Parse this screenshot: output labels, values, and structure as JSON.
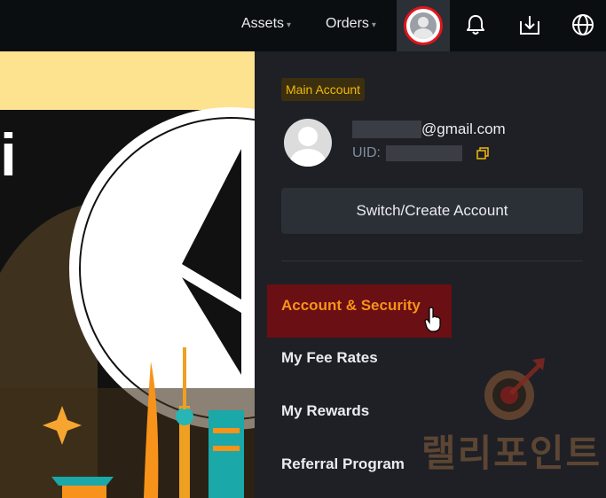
{
  "topbar": {
    "assets_label": "Assets",
    "orders_label": "Orders",
    "caret": "▾",
    "icons": [
      "user-avatar",
      "bell",
      "download",
      "globe"
    ]
  },
  "banner": {
    "letter": "i"
  },
  "account": {
    "badge": "Main Account",
    "email_suffix": "@gmail.com",
    "uid_label": "UID:",
    "switch_label": "Switch/Create Account"
  },
  "menu": {
    "items": [
      {
        "label": "Account & Security",
        "active": true
      },
      {
        "label": "My Fee Rates"
      },
      {
        "label": "My Rewards"
      },
      {
        "label": "Referral Program"
      }
    ]
  },
  "watermark": {
    "text": "랠리포인트"
  },
  "colors": {
    "accent": "#f0b90b",
    "active_bg": "#6a0f13",
    "active_text": "#f7931a",
    "highlight_ring": "#e0161b",
    "panel_bg": "#1e2026"
  }
}
